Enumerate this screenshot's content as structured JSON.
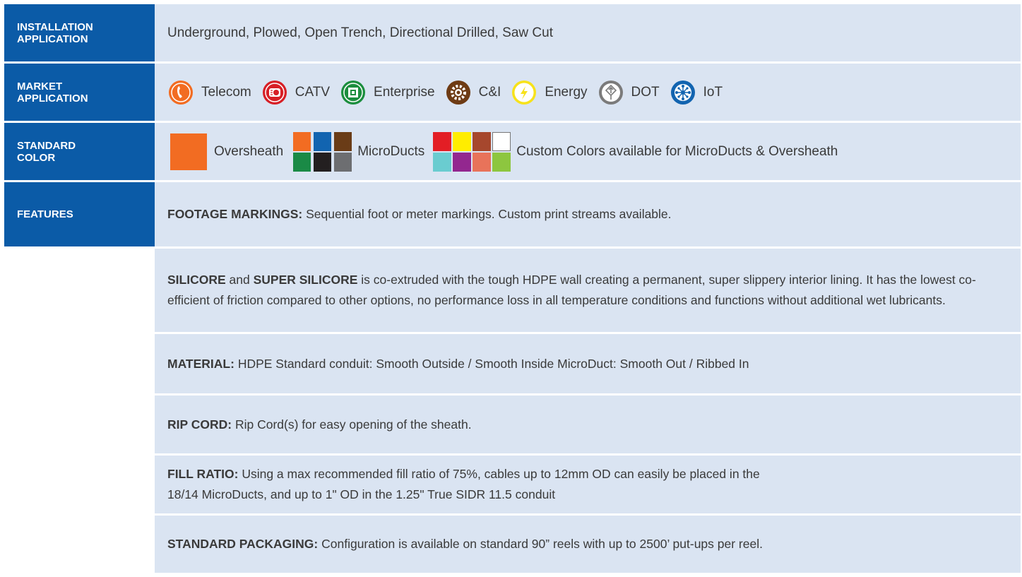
{
  "rows": {
    "installation": {
      "label_line1": "INSTALLATION",
      "label_line2": "APPLICATION",
      "value": "Underground, Plowed, Open Trench, Directional Drilled, Saw Cut"
    },
    "market": {
      "label_line1": "MARKET",
      "label_line2": "APPLICATION",
      "items": [
        {
          "label": "Telecom",
          "icon": "phone-icon",
          "color": "#f26c22"
        },
        {
          "label": "CATV",
          "icon": "cable-reel-icon",
          "color": "#d71f26"
        },
        {
          "label": "Enterprise",
          "icon": "building-icon",
          "color": "#1c8e3e"
        },
        {
          "label": "C&I",
          "icon": "gear-icon",
          "color": "#6e3b14"
        },
        {
          "label": "Energy",
          "icon": "lightning-icon",
          "color": "#f7e21b"
        },
        {
          "label": "DOT",
          "icon": "road-sign-icon",
          "color": "#7b7b7b"
        },
        {
          "label": "IoT",
          "icon": "network-icon",
          "color": "#1264b0"
        }
      ]
    },
    "color": {
      "label_line1": "STANDARD",
      "label_line2": "COLOR",
      "oversheath_label": "Oversheath",
      "oversheath_color": "#f26c22",
      "microducts_label": "MicroDucts",
      "microducts_colors": [
        "#f26c22",
        "#1264b0",
        "#6a3c17",
        "#1a8a46",
        "#231f20",
        "#6d6e71"
      ],
      "custom_colors": [
        "#e31e25",
        "#ffed00",
        "#a6472d",
        "#ffffff",
        "#6accd0",
        "#93278f",
        "#e8735a",
        "#8dc63f"
      ],
      "custom_label": "Custom Colors available for MicroDucts & Oversheath"
    },
    "features": {
      "label": "FEATURES",
      "footage_title": "FOOTAGE MARKINGS:",
      "footage_text": "Sequential foot or meter markings. Custom print streams available.",
      "silicore_title": "SILICORE",
      "silicore_and": "and",
      "silicore_title2": "SUPER SILICORE",
      "silicore_text": "is co-extruded with the tough HDPE wall creating a permanent, super slippery interior lining. It has the lowest co-efficient of friction compared to other options, no performance loss in all temperature conditions and functions without additional wet lubricants.",
      "material_title": "MATERIAL:",
      "material_text": "HDPE Standard conduit: Smooth Outside / Smooth Inside MicroDuct: Smooth Out / Ribbed In",
      "ripcord_title": "RIP CORD:",
      "ripcord_text": "Rip Cord(s) for easy opening of the sheath.",
      "fill_title": "FILL RATIO:",
      "fill_text1": "Using a max recommended fill ratio of 75%, cables up to 12mm OD can easily be placed in the",
      "fill_text2": "18/14 MicroDucts, and up to 1\" OD in the 1.25\" True SIDR 11.5 conduit",
      "packaging_title": "STANDARD PACKAGING:",
      "packaging_text": "Configuration is available on standard 90” reels with up to 2500’ put-ups per reel."
    }
  }
}
